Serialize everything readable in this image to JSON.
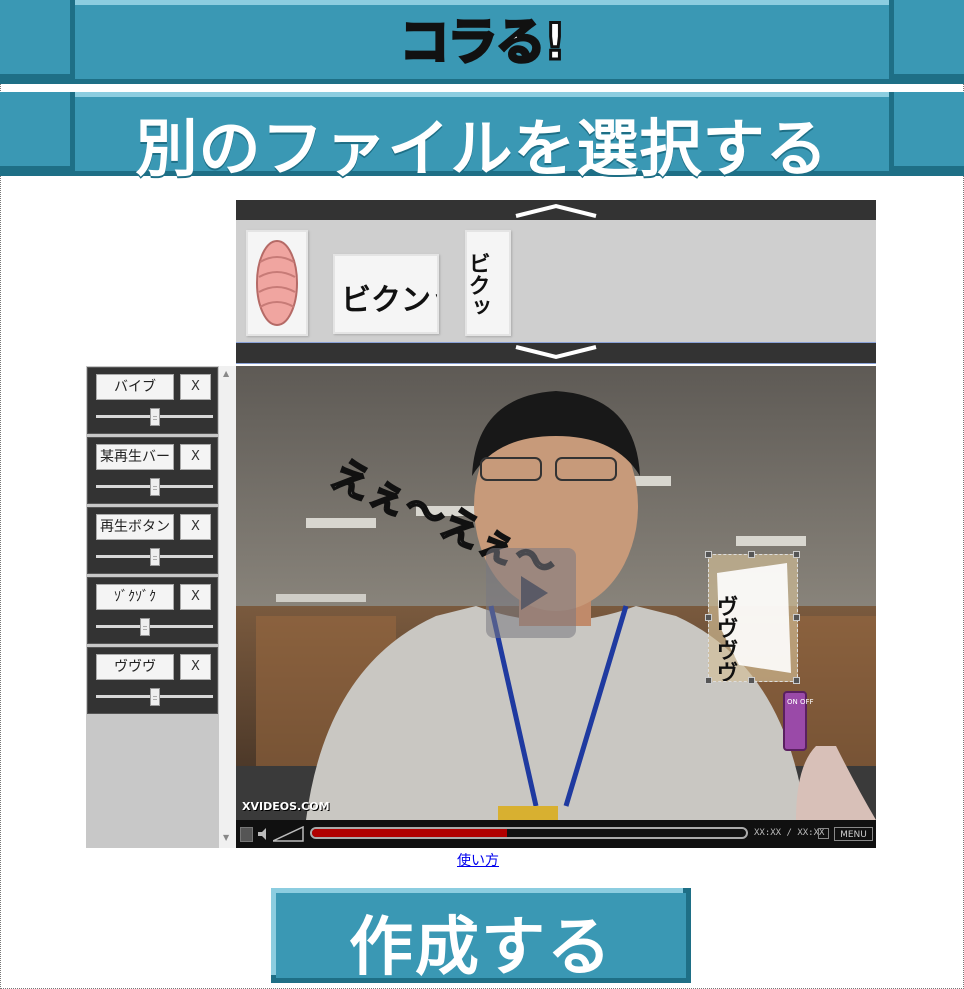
{
  "logo": {
    "text": "コラる!"
  },
  "file_select": {
    "label": "別のファイルを選択する"
  },
  "effects": {
    "thumbnails": [
      {
        "name": "pink-coil"
      },
      {
        "name": "bikun-text",
        "text": "ビクンッ"
      },
      {
        "name": "biku-vertical",
        "text": "ビクッ"
      }
    ]
  },
  "layers": [
    {
      "name": "バイブ",
      "remove": "X",
      "slider": 0.55
    },
    {
      "name": "某再生バー",
      "remove": "X",
      "slider": 0.55
    },
    {
      "name": "再生ボタン",
      "remove": "X",
      "slider": 0.55
    },
    {
      "name": "ｿﾞｸｿﾞｸ",
      "remove": "X",
      "slider": 0.46
    },
    {
      "name": "ヴヴヴ",
      "remove": "X",
      "slider": 0.55
    }
  ],
  "video": {
    "watermark": "XVIDEOS.COM",
    "time": "XX:XX / XX:XX",
    "menu": "MENU",
    "progress": 0.45,
    "sfx_left": "えぇ〜えぇ〜",
    "sfx_vibe": "ヴヴヴヴヴヴ",
    "device_label": "ON OFF"
  },
  "help": {
    "label": "使い方"
  },
  "create": {
    "label": "作成する"
  },
  "colors": {
    "banner": "#3a98b4",
    "banner_dark": "#1e6f86",
    "banner_light": "#8ccde0",
    "progress": "#b00000"
  }
}
